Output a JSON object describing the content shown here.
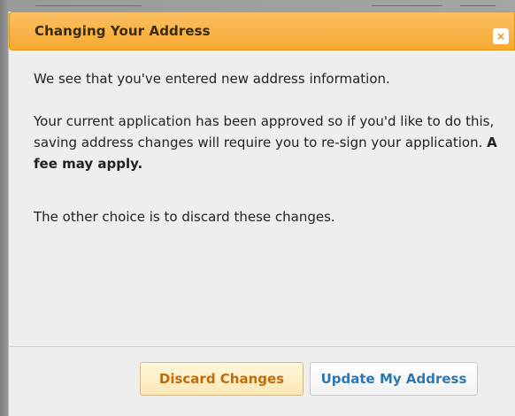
{
  "dialog": {
    "title": "Changing Your Address",
    "close_symbol": "×",
    "intro": "We see that you've entered new address information.",
    "approval_text": "Your current application has been approved so if you'd like to do this, saving address changes will require you to re-sign your application. ",
    "fee_text": "A fee may apply.",
    "discard_text": "The other choice is to discard these changes.",
    "buttons": {
      "discard_label": "Discard Changes",
      "update_label": "Update My Address"
    }
  },
  "colors": {
    "titlebar": "#f6a930",
    "discard_text": "#c06c0a",
    "update_text": "#2f77b3"
  }
}
